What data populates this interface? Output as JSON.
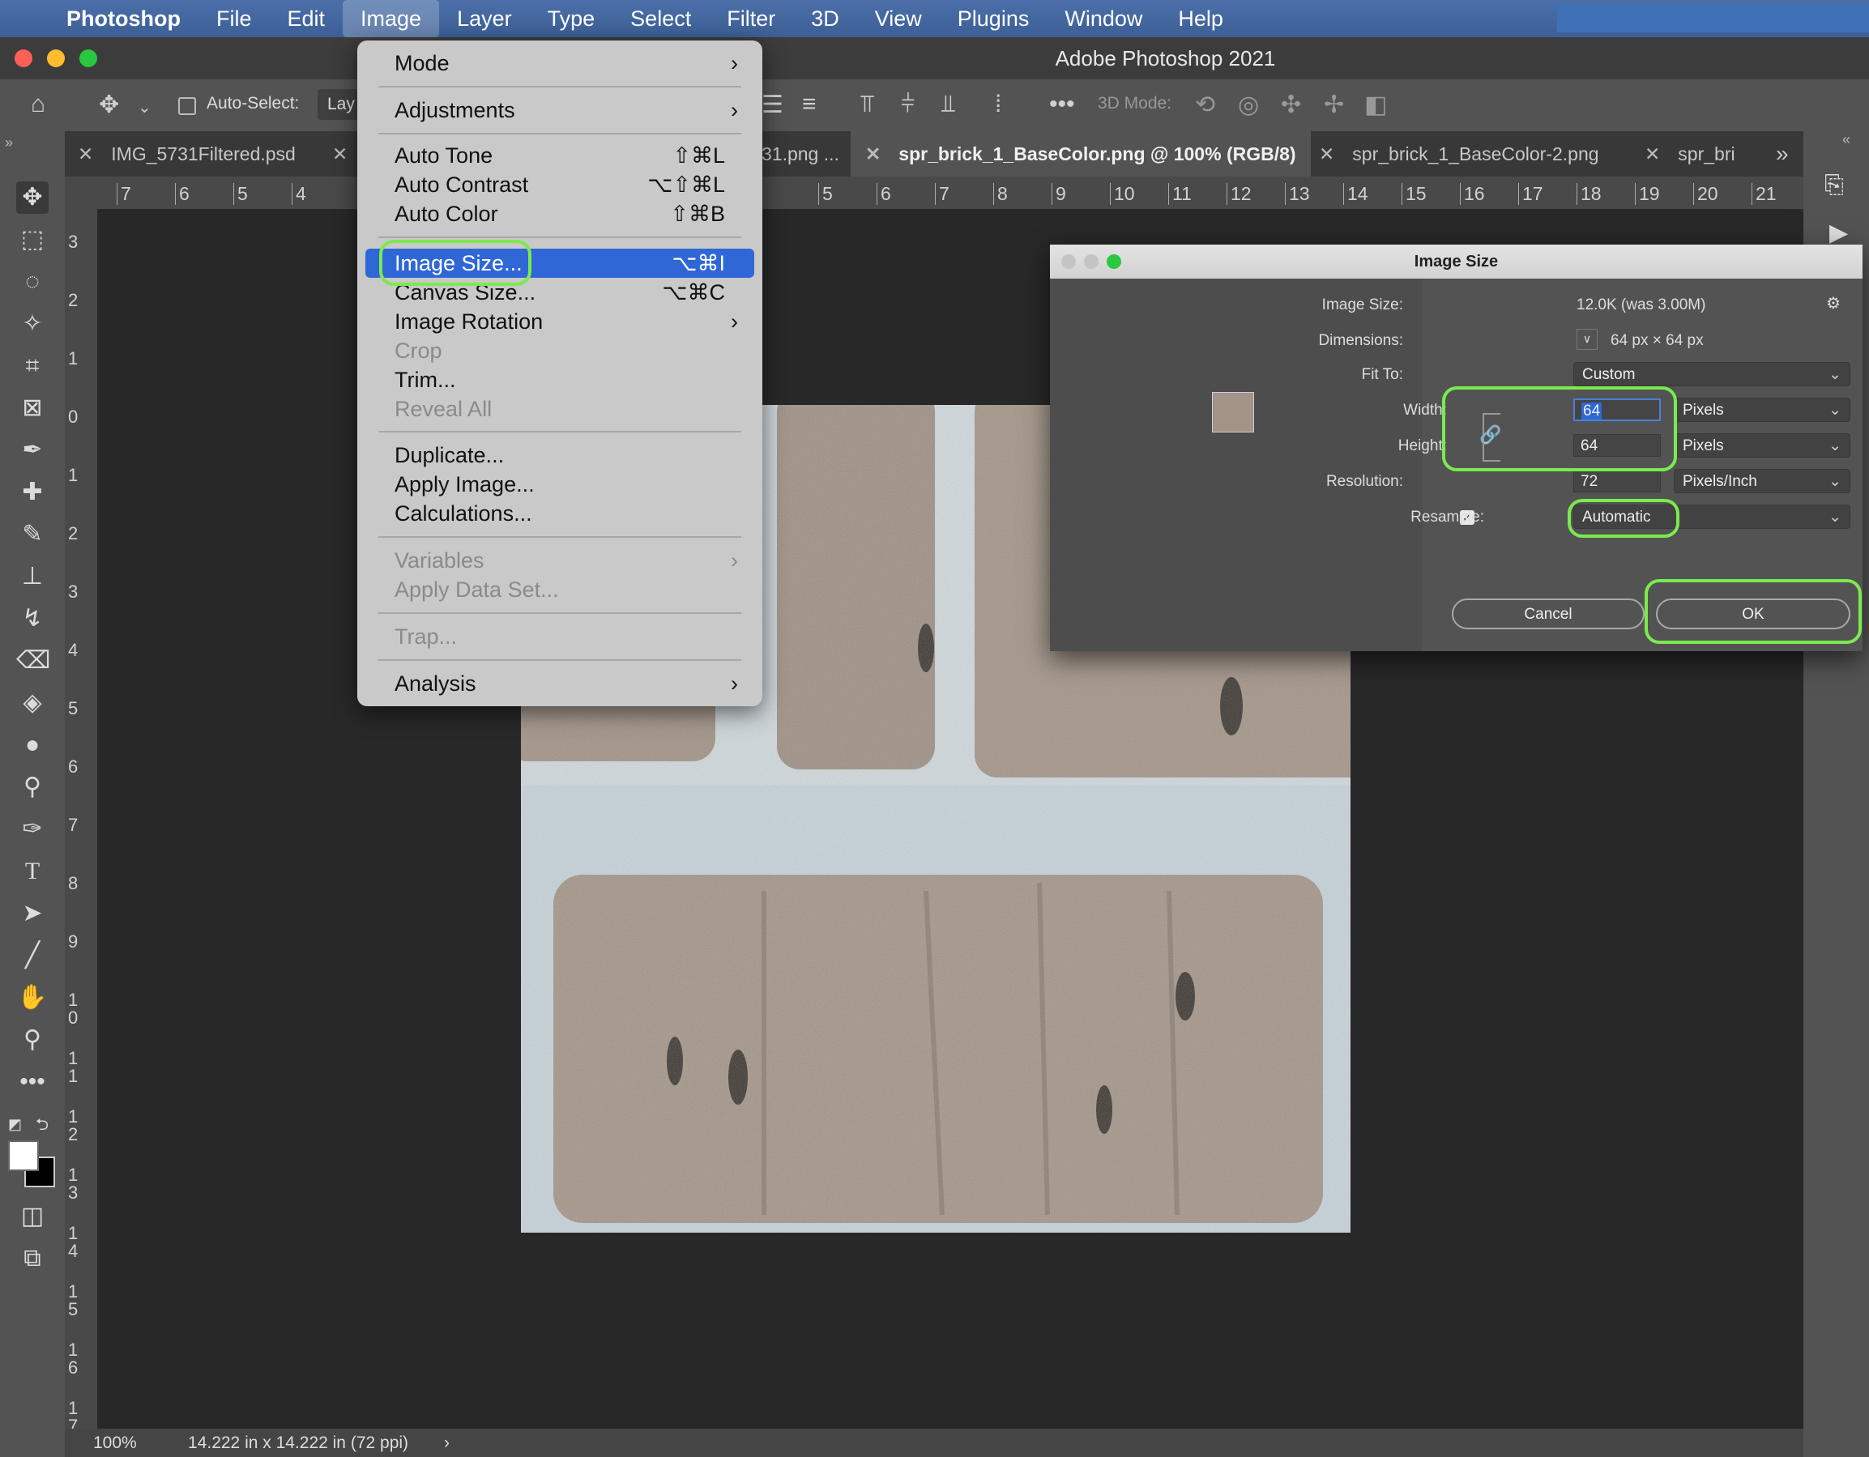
{
  "menubar": {
    "app": "Photoshop",
    "items": [
      "File",
      "Edit",
      "Image",
      "Layer",
      "Type",
      "Select",
      "Filter",
      "3D",
      "View",
      "Plugins",
      "Window",
      "Help"
    ]
  },
  "window": {
    "title": "Adobe Photoshop 2021"
  },
  "options_bar": {
    "auto_select_label": "Auto-Select:",
    "layer_select": "Lay",
    "mode_label": "3D Mode:"
  },
  "tabs": [
    {
      "label": "IMG_5731Filtered.psd"
    },
    {
      "label": "31.png ..."
    },
    {
      "label": "spr_brick_1_BaseColor.png @ 100% (RGB/8)"
    },
    {
      "label": "spr_brick_1_BaseColor-2.png"
    },
    {
      "label": "spr_bri"
    }
  ],
  "ruler": {
    "h": [
      "7",
      "6",
      "5",
      "4",
      "5",
      "6",
      "7",
      "8",
      "9",
      "10",
      "11",
      "12",
      "13",
      "14",
      "15",
      "16",
      "17",
      "18",
      "19",
      "20",
      "21"
    ],
    "v": [
      "3",
      "2",
      "1",
      "0",
      "1",
      "2",
      "3",
      "4",
      "5",
      "6",
      "7",
      "8",
      "9",
      "10",
      "11",
      "12",
      "13",
      "14",
      "15",
      "16",
      "17"
    ]
  },
  "image_menu": {
    "mode": "Mode",
    "adjustments": "Adjustments",
    "auto_tone": "Auto Tone",
    "auto_tone_sc": "⇧⌘L",
    "auto_contrast": "Auto Contrast",
    "auto_contrast_sc": "⌥⇧⌘L",
    "auto_color": "Auto Color",
    "auto_color_sc": "⇧⌘B",
    "image_size": "Image Size...",
    "image_size_sc": "⌥⌘I",
    "canvas_size": "Canvas Size...",
    "canvas_size_sc": "⌥⌘C",
    "image_rotation": "Image Rotation",
    "crop": "Crop",
    "trim": "Trim...",
    "reveal_all": "Reveal All",
    "duplicate": "Duplicate...",
    "apply_image": "Apply Image...",
    "calculations": "Calculations...",
    "variables": "Variables",
    "apply_data_set": "Apply Data Set...",
    "trap": "Trap...",
    "analysis": "Analysis"
  },
  "dialog": {
    "title": "Image Size",
    "image_size_label": "Image Size:",
    "image_size_value": "12.0K (was 3.00M)",
    "dimensions_label": "Dimensions:",
    "dimensions_value": "64 px  ×  64 px",
    "fit_to_label": "Fit To:",
    "fit_to_value": "Custom",
    "width_label": "Width:",
    "width_value": "64",
    "width_unit": "Pixels",
    "height_label": "Height:",
    "height_value": "64",
    "height_unit": "Pixels",
    "resolution_label": "Resolution:",
    "resolution_value": "72",
    "resolution_unit": "Pixels/Inch",
    "resample_label": "Resample:",
    "resample_value": "Automatic",
    "cancel": "Cancel",
    "ok": "OK"
  },
  "status": {
    "zoom": "100%",
    "doc": "14.222 in x 14.222 in (72 ppi)"
  },
  "colors": {
    "highlight": "#2f67d6",
    "annotation": "#7bea4e",
    "menubar": "#4a6fa8"
  }
}
